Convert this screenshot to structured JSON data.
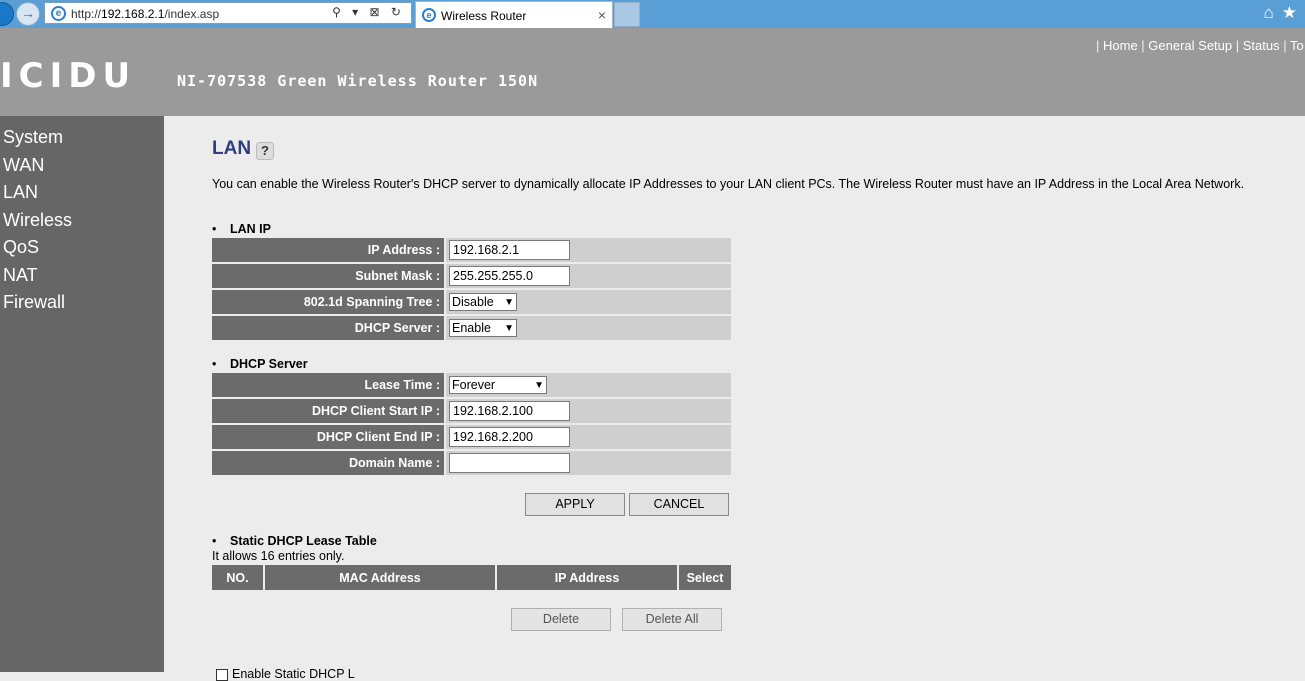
{
  "browser": {
    "url_prefix": "http://",
    "url_host": "192.168.2.1",
    "url_path": "/index.asp",
    "tab_title": "Wireless Router",
    "tab_close": "×",
    "address_controls": "⚲ ▾ ⊠ ↻"
  },
  "header": {
    "logo": "ICIDU",
    "model": "NI-707538 Green Wireless Router 150N",
    "links": [
      "Home",
      "General Setup",
      "Status",
      "To"
    ]
  },
  "sidebar": {
    "items": [
      "System",
      "WAN",
      "LAN",
      "Wireless",
      "QoS",
      "NAT",
      "Firewall"
    ]
  },
  "page": {
    "title": "LAN",
    "intro": "You can enable the Wireless Router's DHCP server to dynamically allocate IP Addresses to your LAN client PCs. The Wireless Router must have an IP Address in the Local Area Network."
  },
  "lan_ip": {
    "heading": "LAN IP",
    "ip_label": "IP Address :",
    "ip_value": "192.168.2.1",
    "mask_label": "Subnet Mask :",
    "mask_value": "255.255.255.0",
    "stp_label": "802.1d Spanning Tree :",
    "stp_value": "Disable",
    "dhcp_label": "DHCP Server :",
    "dhcp_value": "Enable"
  },
  "dhcp": {
    "heading": "DHCP Server",
    "lease_label": "Lease Time :",
    "lease_value": "Forever",
    "start_label": "DHCP Client Start IP :",
    "start_value": "192.168.2.100",
    "end_label": "DHCP Client End IP :",
    "end_value": "192.168.2.200",
    "domain_label": "Domain Name :",
    "domain_value": ""
  },
  "actions": {
    "apply": "APPLY",
    "cancel": "CANCEL"
  },
  "static_table": {
    "heading": "Static DHCP Lease Table",
    "note": "It allows 16 entries only.",
    "columns": [
      "NO.",
      "MAC Address",
      "IP Address",
      "Select"
    ],
    "delete": "Delete",
    "delete_all": "Delete All",
    "enable_label": "Enable Static DHCP L"
  },
  "icons": {
    "home": "⌂",
    "star": "★",
    "forward": "→",
    "ie": "e",
    "help": "?"
  }
}
